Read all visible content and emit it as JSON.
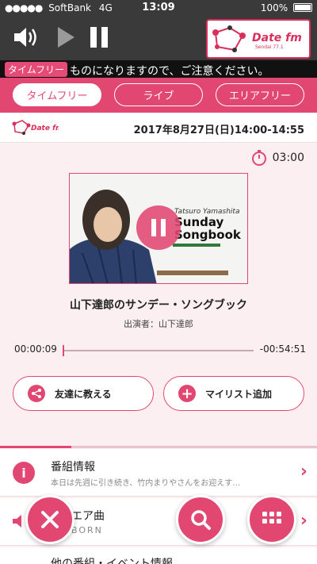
{
  "status_bar": {
    "carrier": "SoftBank",
    "network": "4G",
    "time": "13:09",
    "battery": "100%"
  },
  "player": {
    "station_logo_text": "Date fm",
    "station_logo_sub": "Sendai 77.1"
  },
  "ticker": {
    "tag": "タイムフリー",
    "message": "ものになりますので、ご注意ください。"
  },
  "tabs": [
    {
      "label": "タイムフリー"
    },
    {
      "label": "ライブ"
    },
    {
      "label": "エリアフリー"
    }
  ],
  "station": {
    "datetime": "2017年8月27日(日)14:00-14:55"
  },
  "timer": "03:00",
  "artwork": {
    "line1": "Tatsuro Yamashita",
    "line2": "Sunday",
    "line3": "Songbook"
  },
  "program": {
    "title": "山下達郎のサンデー・ソングブック",
    "cast": "出演者：山下達郎"
  },
  "progress": {
    "elapsed": "00:00:09",
    "remaining": "-00:54:51"
  },
  "actions": {
    "share": "友達に教える",
    "mylist": "マイリスト追加"
  },
  "rows": {
    "info_title": "番組情報",
    "info_sub": "本日は先週に引き続き、竹内まりやさんをお迎えす…",
    "song_title": "エア曲",
    "song_sub": "BORN",
    "next_title": "他の番組・イベント情報"
  },
  "colors": {
    "accent": "#e24772",
    "header": "#3a3a3a",
    "background": "#fbeff1"
  }
}
